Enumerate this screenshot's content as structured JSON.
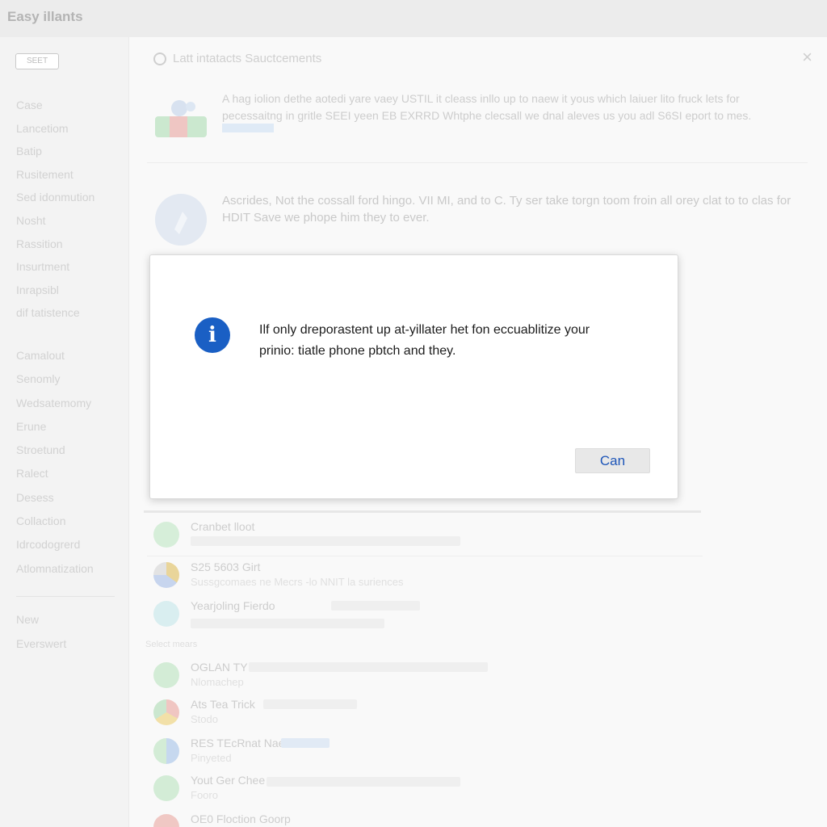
{
  "app": {
    "title": "Easy illants"
  },
  "sidebar": {
    "button_label": "SEET",
    "group_a": [
      "Case",
      "Lancetiom",
      "Batip",
      "Rusitement",
      "Sed idonmution",
      "Nosht",
      "Rassition",
      "Insurtment",
      "Inrapsibl",
      "dif tatistence"
    ],
    "group_b": [
      "Camalout",
      "Senomly",
      "Wedsatemomy",
      "Erune",
      "Stroetund",
      "Ralect",
      "Desess",
      "Collaction",
      "Idrcodogrerd",
      "Atlomnatization"
    ],
    "group_c": [
      "New",
      "Everswert"
    ]
  },
  "main": {
    "close_glyph": "×",
    "section_title": "Latt intatacts Sauctcements",
    "card1_text": "A hag iolion dethe aotedi yare vaey USTIL it cleass inllo up to naew it yous which laiuer lito fruck lets for pecessaitng in gritle SEEI yeen EB EXRRD Whtphe clecsall we dnal aleves us you adl S6SI eport to mes.",
    "card2_text": "Ascrides, Not the cossall ford hingo. VII MI, and to C. Ty ser take torgn toom froin all orey clat to to clas for HDIT Save we phope him they to ever.",
    "section_label": "Select mears",
    "list": [
      {
        "title": "Cranbet lloot",
        "sub": "",
        "icon_color": "#cfe9d4"
      },
      {
        "title": "S25 5603 Girt",
        "sub": "Sussgcomaes ne Mecrs -lo NNIT la suriences",
        "icon_color": "#c8d6ee"
      },
      {
        "title": "Yearjoling Fierdo",
        "sub": "",
        "icon_color": "#d4ecec"
      },
      {
        "title": "OGLAN TY",
        "sub": "Nlomachep",
        "icon_color": "#cfe9d4"
      },
      {
        "title": "Ats Tea Trick",
        "sub": "Stodo",
        "icon_color": "#f0c8c4"
      },
      {
        "title": "RES TEcRnat Nae",
        "sub": "Pinyeted",
        "icon_color": "#cde0f0"
      },
      {
        "title": "Yout Ger Chee",
        "sub": "Fooro",
        "icon_color": "#cfe9d4"
      },
      {
        "title": "OE0 Floction Goorp",
        "sub": "",
        "icon_color": "#f0c8c4"
      }
    ]
  },
  "dialog": {
    "icon": "info-icon",
    "icon_glyph": "i",
    "message_line1": "Ilf only dreporastent up at-yillater het fon eccuablitize your",
    "message_line2": "prinio: tiatle phone pbtch and they.",
    "button_label": "Can",
    "accent_color": "#1a5fc4"
  }
}
